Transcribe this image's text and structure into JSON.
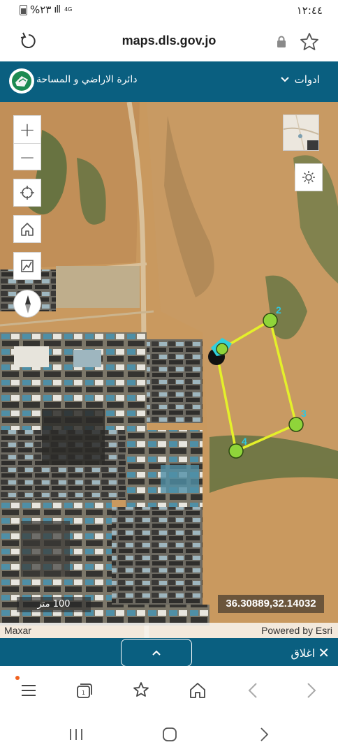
{
  "status": {
    "time": "١٢:٤٤",
    "battery": "%٢٣",
    "network": "4G"
  },
  "browser": {
    "url": "maps.dls.gov.jo"
  },
  "header": {
    "title": "دائرة الاراضي و المساحة",
    "tools_label": "ادوات"
  },
  "map": {
    "scale_label": "100 متر",
    "coordinates": "36.30889,32.14032",
    "attribution_left": "Maxar",
    "attribution_right": "Powered by Esri",
    "vertex_labels": [
      "2",
      "3",
      "4"
    ],
    "polygon_color": "#e4f02a",
    "vertex_color": "#8fd43a",
    "label_color": "#2ec7e0"
  },
  "bottom_panel": {
    "close_label": "اغلاق"
  },
  "colors": {
    "header_bg": "#0a5f80",
    "accent_dot": "#f0621f"
  }
}
